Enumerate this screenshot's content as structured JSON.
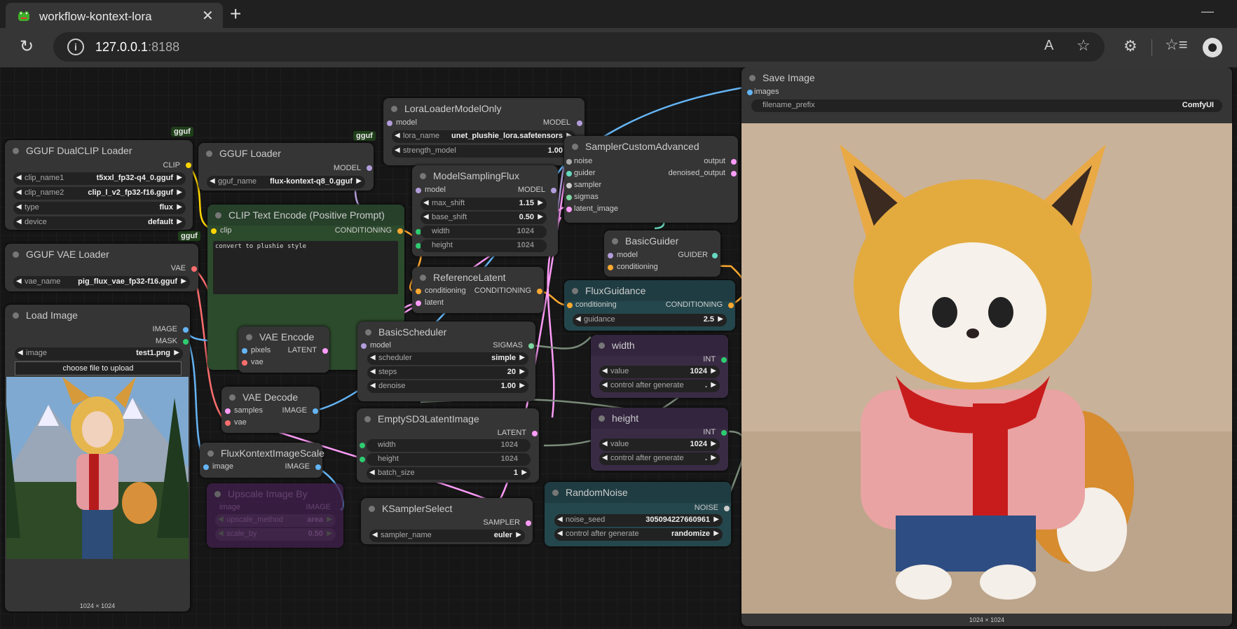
{
  "browser": {
    "tab_title": "workflow-kontext-lora",
    "close_glyph": "✕",
    "new_tab_glyph": "+",
    "minimize_glyph": "—",
    "url_host": "127.0.0.1",
    "url_port": ":8188",
    "read_aloud_glyph": "A",
    "info_glyph": "i",
    "reload_glyph": "↻",
    "star_glyph": "☆",
    "extensions_glyph": "⚙",
    "favorites_glyph": "☆≡"
  },
  "badges": {
    "gguf": "gguf"
  },
  "nodes": {
    "save_image": {
      "title": "Save Image",
      "input_images": "images",
      "filename_prefix_label": "filename_prefix",
      "filename_prefix": "ComfyUI",
      "size": "1024 × 1024"
    },
    "lora_loader": {
      "title": "LoraLoaderModelOnly",
      "in_model": "model",
      "out_model": "MODEL",
      "lora_name_label": "lora_name",
      "lora_name": "unet_plushie_lora.safetensors",
      "strength_model_label": "strength_model",
      "strength_model": "1.00"
    },
    "gguf_dualclip": {
      "title": "GGUF DualCLIP Loader",
      "out_clip": "CLIP",
      "clip_name1_label": "clip_name1",
      "clip_name1": "t5xxl_fp32-q4_0.gguf",
      "clip_name2_label": "clip_name2",
      "clip_name2": "clip_l_v2_fp32-f16.gguf",
      "type_label": "type",
      "type": "flux",
      "device_label": "device",
      "device": "default"
    },
    "gguf_loader": {
      "title": "GGUF Loader",
      "out_model": "MODEL",
      "gguf_name_label": "gguf_name",
      "gguf_name": "flux-kontext-q8_0.gguf"
    },
    "model_sampling_flux": {
      "title": "ModelSamplingFlux",
      "in_model": "model",
      "out_model": "MODEL",
      "max_shift_label": "max_shift",
      "max_shift": "1.15",
      "base_shift_label": "base_shift",
      "base_shift": "0.50",
      "width_label": "width",
      "width": "1024",
      "height_label": "height",
      "height": "1024"
    },
    "sampler_custom_advanced": {
      "title": "SamplerCustomAdvanced",
      "in_noise": "noise",
      "in_guider": "guider",
      "in_sampler": "sampler",
      "in_sigmas": "sigmas",
      "in_latent": "latent_image",
      "out_output": "output",
      "out_denoised": "denoised_output"
    },
    "clip_text_encode": {
      "title": "CLIP Text Encode (Positive Prompt)",
      "in_clip": "clip",
      "out_conditioning": "CONDITIONING",
      "prompt": "convert to plushie style"
    },
    "basic_guider": {
      "title": "BasicGuider",
      "in_model": "model",
      "in_conditioning": "conditioning",
      "out_guider": "GUIDER"
    },
    "gguf_vae_loader": {
      "title": "GGUF VAE Loader",
      "out_vae": "VAE",
      "vae_name_label": "vae_name",
      "vae_name": "pig_flux_vae_fp32-f16.gguf"
    },
    "reference_latent": {
      "title": "ReferenceLatent",
      "in_conditioning": "conditioning",
      "in_latent": "latent",
      "out_conditioning": "CONDITIONING"
    },
    "flux_guidance": {
      "title": "FluxGuidance",
      "in_conditioning": "conditioning",
      "out_conditioning": "CONDITIONING",
      "guidance_label": "guidance",
      "guidance": "2.5"
    },
    "load_image": {
      "title": "Load Image",
      "out_image": "IMAGE",
      "out_mask": "MASK",
      "image_label": "image",
      "image": "test1.png",
      "upload_label": "choose file to upload",
      "size": "1024 × 1024"
    },
    "vae_encode": {
      "title": "VAE Encode",
      "in_pixels": "pixels",
      "in_vae": "vae",
      "out_latent": "LATENT"
    },
    "basic_scheduler": {
      "title": "BasicScheduler",
      "in_model": "model",
      "out_sigmas": "SIGMAS",
      "scheduler_label": "scheduler",
      "scheduler": "simple",
      "steps_label": "steps",
      "steps": "20",
      "denoise_label": "denoise",
      "denoise": "1.00"
    },
    "width_node": {
      "title": "width",
      "out_int": "INT",
      "value_label": "value",
      "value": "1024",
      "control_label": "control after generate",
      "control": "."
    },
    "vae_decode": {
      "title": "VAE Decode",
      "in_samples": "samples",
      "in_vae": "vae",
      "out_image": "IMAGE"
    },
    "empty_latent": {
      "title": "EmptySD3LatentImage",
      "out_latent": "LATENT",
      "width_label": "width",
      "width": "1024",
      "height_label": "height",
      "height": "1024",
      "batch_size_label": "batch_size",
      "batch_size": "1"
    },
    "height_node": {
      "title": "height",
      "out_int": "INT",
      "value_label": "value",
      "value": "1024",
      "control_label": "control after generate",
      "control": "."
    },
    "flux_kontext_scale": {
      "title": "FluxKontextImageScale",
      "in_image": "image",
      "out_image": "IMAGE"
    },
    "upscale_image_by": {
      "title": "Upscale Image By",
      "in_image": "image",
      "out_image": "IMAGE",
      "upscale_method_label": "upscale_method",
      "upscale_method": "area",
      "scale_by_label": "scale_by",
      "scale_by": "0.50"
    },
    "random_noise": {
      "title": "RandomNoise",
      "out_noise": "NOISE",
      "noise_seed_label": "noise_seed",
      "noise_seed": "305094227660961",
      "control_label": "control after generate",
      "control": "randomize"
    },
    "ksampler_select": {
      "title": "KSamplerSelect",
      "out_sampler": "SAMPLER",
      "sampler_name_label": "sampler_name",
      "sampler_name": "euler"
    }
  },
  "colors": {
    "canvas": "#161616",
    "node": "#353535",
    "green_node": "#2c4a2c",
    "purple_node": "#3a2b45",
    "teal_node": "#24474d",
    "conditioning": "#ffa931",
    "model": "#b39ddb",
    "clip": "#ffd500",
    "vae": "#ff6e6e",
    "image": "#64b5f6",
    "latent": "#ff9cf9",
    "int": "#2ecc71"
  }
}
